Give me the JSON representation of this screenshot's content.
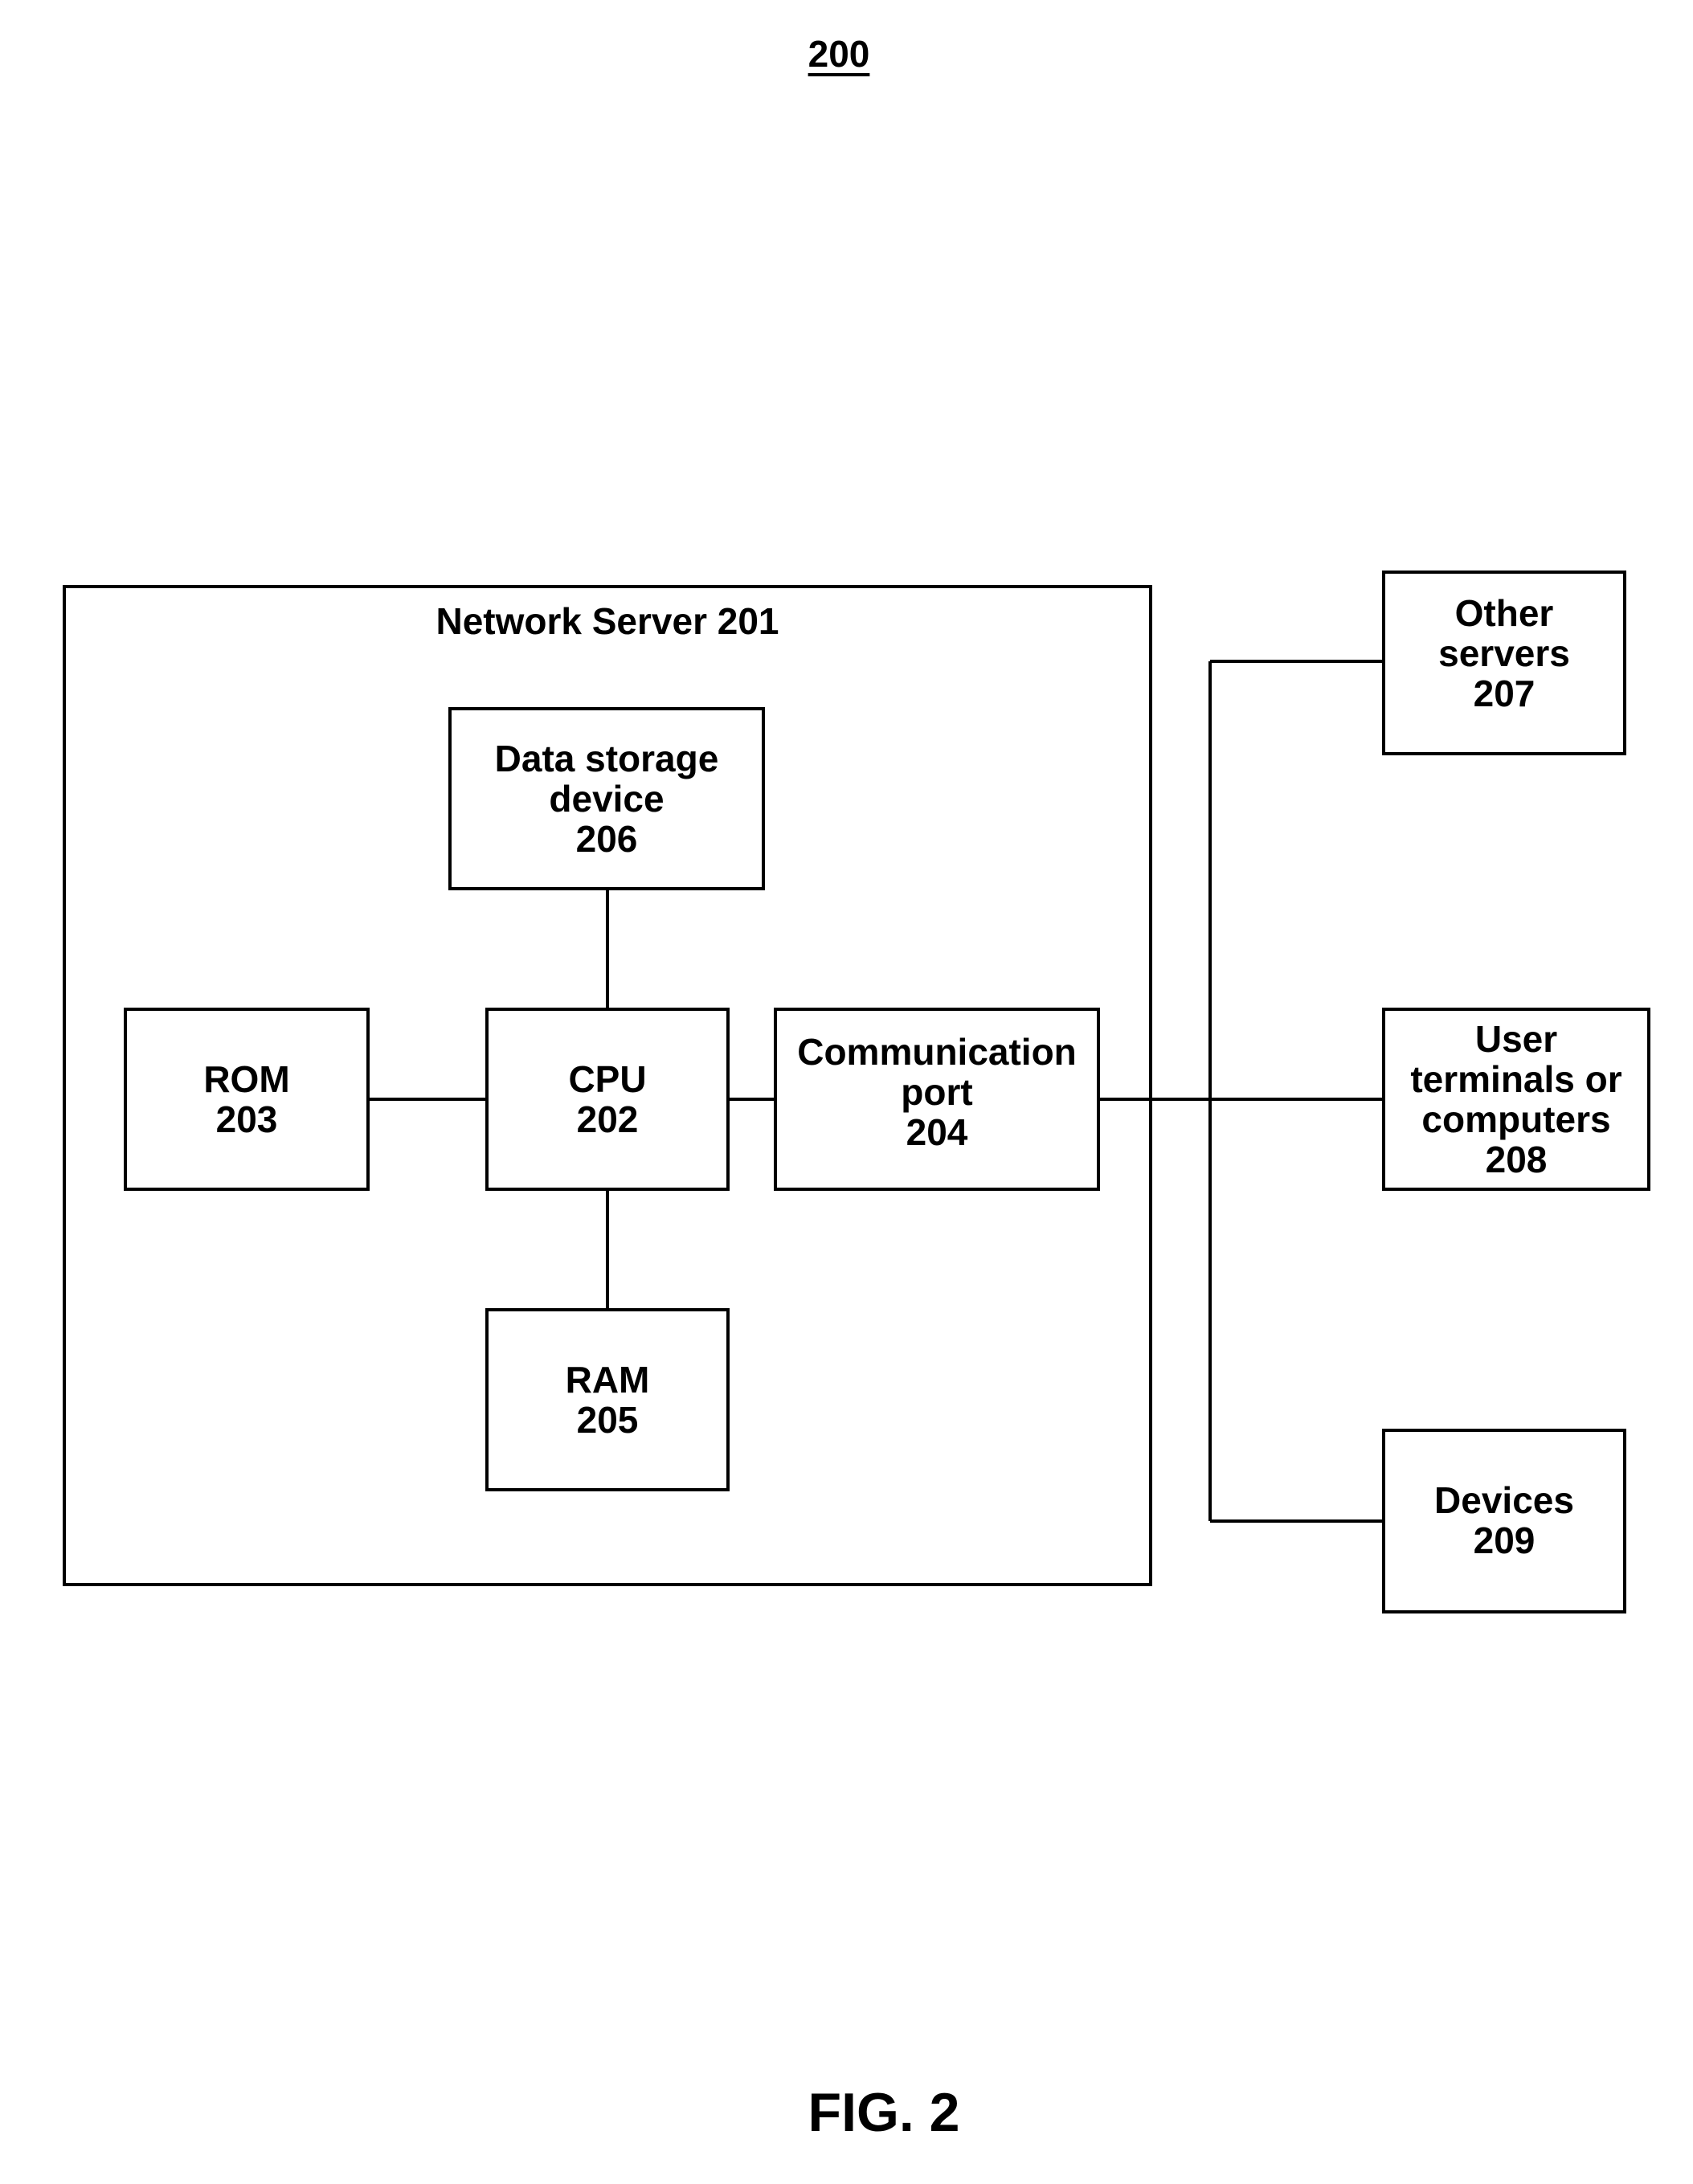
{
  "figure": {
    "reference_numeral": "200",
    "caption": "FIG. 2"
  },
  "network_server": {
    "title": "Network Server 201",
    "components": {
      "data_storage": {
        "lines": [
          "Data storage",
          "device",
          "206"
        ]
      },
      "rom": {
        "lines": [
          "ROM",
          "203"
        ]
      },
      "cpu": {
        "lines": [
          "CPU",
          "202"
        ]
      },
      "comm_port": {
        "lines": [
          "Communication",
          "port",
          "204"
        ]
      },
      "ram": {
        "lines": [
          "RAM",
          "205"
        ]
      }
    }
  },
  "external": {
    "other_servers": {
      "lines": [
        "Other",
        "servers",
        "207"
      ]
    },
    "user_terminals": {
      "lines": [
        "User",
        "terminals or",
        "computers",
        "208"
      ]
    },
    "devices": {
      "lines": [
        "Devices",
        "209"
      ]
    }
  },
  "connections": [
    {
      "from": "CPU 202",
      "to": "Data storage device 206"
    },
    {
      "from": "CPU 202",
      "to": "ROM 203"
    },
    {
      "from": "CPU 202",
      "to": "RAM 205"
    },
    {
      "from": "CPU 202",
      "to": "Communication port 204"
    },
    {
      "from": "Communication port 204",
      "to": "Other servers 207"
    },
    {
      "from": "Communication port 204",
      "to": "User terminals or computers 208"
    },
    {
      "from": "Communication port 204",
      "to": "Devices 209"
    }
  ]
}
